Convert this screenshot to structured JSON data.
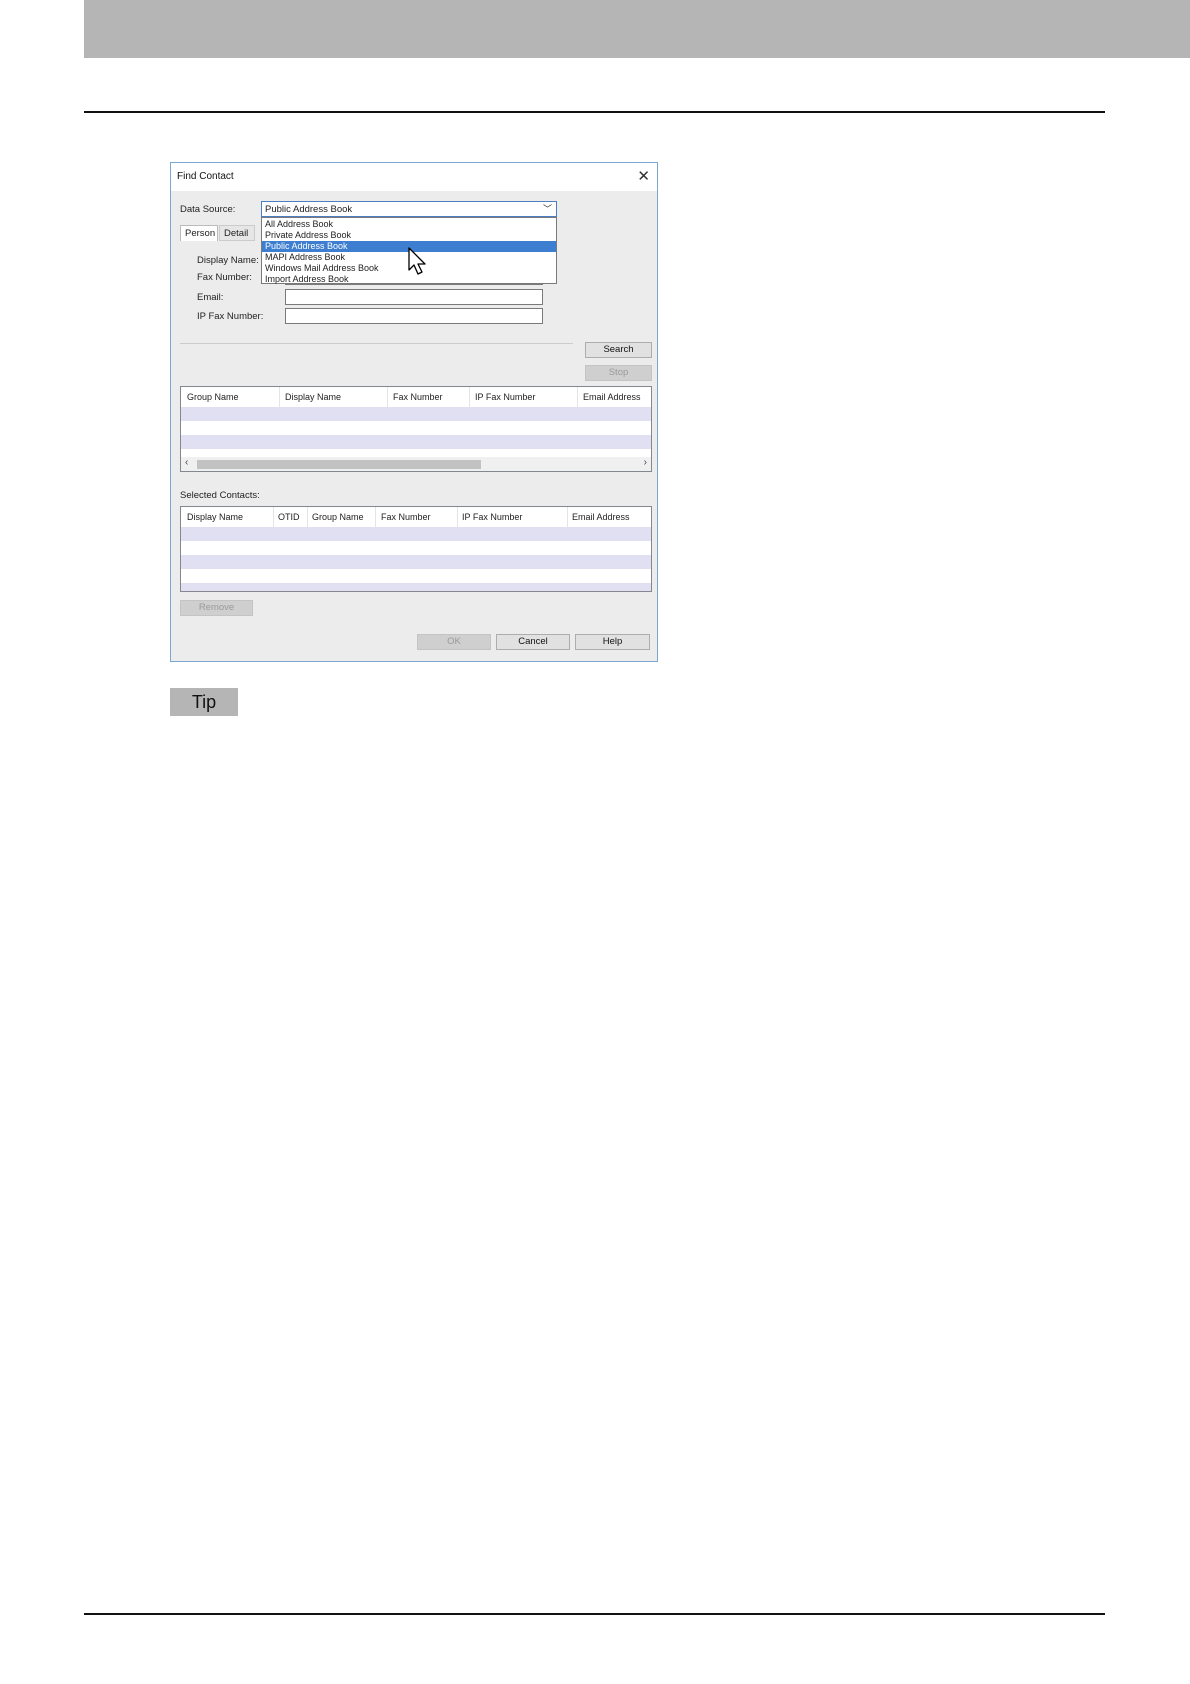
{
  "dialog": {
    "title": "Find Contact",
    "data_source_label": "Data Source:",
    "data_source_value": "Public Address Book",
    "data_source_options": [
      "All Address Book",
      "Private Address Book",
      "Public Address Book",
      "MAPI Address Book",
      "Windows Mail Address Book",
      "Import Address Book"
    ],
    "selected_option": "Public Address Book",
    "tabs": [
      "Person",
      "Detail Se"
    ],
    "fields": {
      "display_name_label": "Display Name:",
      "fax_number_label": "Fax Number:",
      "email_label": "Email:",
      "ip_fax_number_label": "IP Fax Number:"
    },
    "search_button": "Search",
    "stop_button": "Stop",
    "results_columns": [
      "Group Name",
      "Display Name",
      "Fax Number",
      "IP Fax Number",
      "Email Address"
    ],
    "selected_contacts_label": "Selected Contacts:",
    "selected_columns": [
      "Display Name",
      "OTID",
      "Group Name",
      "Fax Number",
      "IP Fax Number",
      "Email Address"
    ],
    "remove_button": "Remove",
    "ok_button": "OK",
    "cancel_button": "Cancel",
    "help_button": "Help"
  },
  "tip_label": "Tip",
  "colors": {
    "header_bar": "#b5b5b5",
    "selection": "#3e7ed1",
    "row_alt": "#e0e0f2"
  }
}
